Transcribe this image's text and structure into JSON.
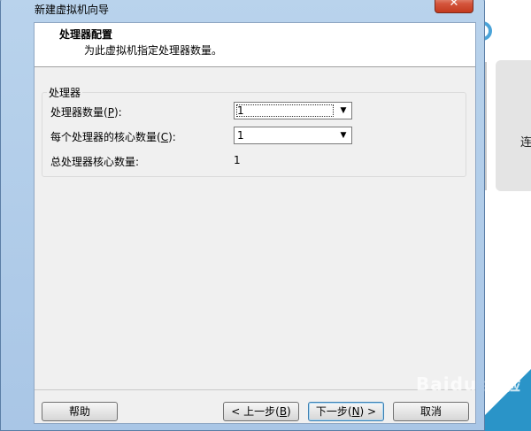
{
  "window": {
    "title": "新建虚拟机向导",
    "close_label": "✕"
  },
  "header": {
    "title": "处理器配置",
    "subtitle": "为此虚拟机指定处理器数量。"
  },
  "processor_group": {
    "legend": "处理器",
    "processor_count": {
      "label_prefix": "处理器数量(",
      "accesskey": "P",
      "label_suffix": "):",
      "value": "1"
    },
    "cores_per_processor": {
      "label_prefix": "每个处理器的核心数量(",
      "accesskey": "C",
      "label_suffix": "):",
      "value": "1"
    },
    "total_cores": {
      "label": "总处理器核心数量:",
      "value": "1"
    }
  },
  "buttons": {
    "help": "帮助",
    "back_prefix": "< 上一步(",
    "back_key": "B",
    "back_suffix": ")",
    "next_prefix": "下一步(",
    "next_key": "N",
    "next_suffix": ") >",
    "cancel": "取消"
  },
  "background_app": {
    "panel_text": "连"
  },
  "watermark": "Baidu 经验",
  "colors": {
    "titlebar": "#b9d3ec",
    "close_button": "#c33a1f",
    "accent": "#2a94c8"
  }
}
